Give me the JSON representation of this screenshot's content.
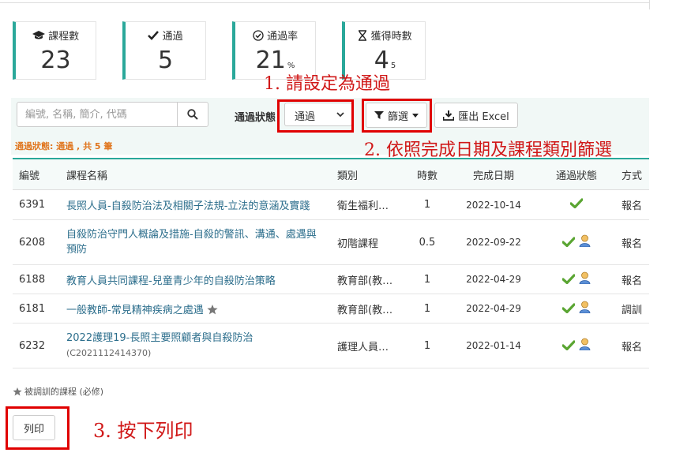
{
  "stats": [
    {
      "label": "課程數",
      "value": "23",
      "suffix": "",
      "icon": "graduation-cap-icon"
    },
    {
      "label": "通過",
      "value": "5",
      "suffix": "",
      "icon": "check-icon"
    },
    {
      "label": "通過率",
      "value": "21",
      "suffix": "%",
      "icon": "check-circle-icon"
    },
    {
      "label": "獲得時數",
      "value": "4",
      "suffix": "5",
      "icon": "hourglass-icon"
    }
  ],
  "search": {
    "placeholder": "編號, 名稱, 簡介, 代碼"
  },
  "filter": {
    "label": "通過狀態",
    "selected": "通過"
  },
  "buttons": {
    "filter": "篩選",
    "export": "匯出 Excel",
    "print": "列印"
  },
  "status_note": "通過狀態: 通過 , 共 5 筆",
  "annotations": [
    "1. 請設定為通過",
    "2. 依照完成日期及課程類別篩選",
    "3. 按下列印"
  ],
  "table": {
    "headers": [
      "編號",
      "課程名稱",
      "類別",
      "時數",
      "完成日期",
      "通過狀態",
      "方式"
    ],
    "rows": [
      {
        "id": "6391",
        "name": "長照人員-自殺防治法及相關子法規-立法的意涵及實踐",
        "code": "",
        "category": "衛生福利…",
        "hours": "1",
        "date": "2022-10-14",
        "method": "報名"
      },
      {
        "id": "6208",
        "name": "自殺防治守門人概論及措施-自殺的警訊、溝通、處遇與預防",
        "code": "",
        "category": "初階課程",
        "hours": "0.5",
        "date": "2022-09-22",
        "method": "報名"
      },
      {
        "id": "6188",
        "name": "教育人員共同課程-兒童青少年的自殺防治策略",
        "code": "",
        "category": "教育部(教…",
        "hours": "1",
        "date": "2022-04-29",
        "method": "報名"
      },
      {
        "id": "6181",
        "name": "一般教師-常見精神疾病之處遇",
        "code": "",
        "category": "教育部(教…",
        "hours": "1",
        "date": "2022-04-29",
        "method": "調訓"
      },
      {
        "id": "6232",
        "name": "2022護理19-長照主要照顧者與自殺防治",
        "code": "(C2021112414370)",
        "category": "護理人員…",
        "hours": "1",
        "date": "2022-01-14",
        "method": "報名"
      }
    ]
  },
  "legend": "被調訓的課程 (必修)",
  "colors": {
    "accent": "#2aa89a",
    "link": "#2c6e8c",
    "annotation": "#d01818",
    "note": "#e0761f"
  }
}
